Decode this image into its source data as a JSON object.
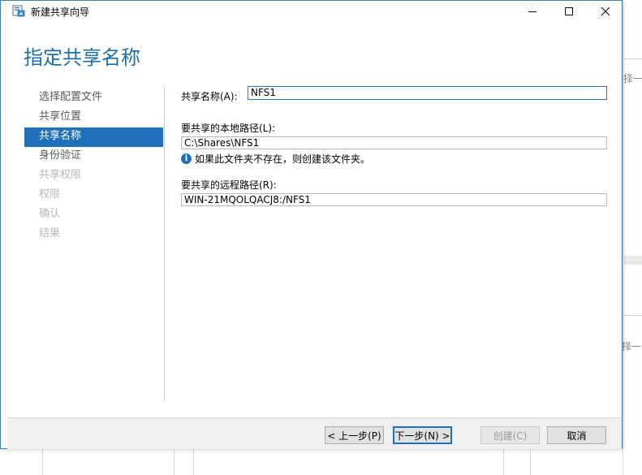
{
  "window": {
    "title": "新建共享向导"
  },
  "page": {
    "heading": "指定共享名称"
  },
  "nav": {
    "items": [
      {
        "label": "选择配置文件",
        "state": "normal"
      },
      {
        "label": "共享位置",
        "state": "normal"
      },
      {
        "label": "共享名称",
        "state": "active"
      },
      {
        "label": "身份验证",
        "state": "normal"
      },
      {
        "label": "共享权限",
        "state": "disabled"
      },
      {
        "label": "权限",
        "state": "disabled"
      },
      {
        "label": "确认",
        "state": "disabled"
      },
      {
        "label": "结果",
        "state": "disabled"
      }
    ]
  },
  "form": {
    "share_name_label": "共享名称(A):",
    "share_name_value": "NFS1",
    "local_path_label": "要共享的本地路径(L):",
    "local_path_value": "C:\\Shares\\NFS1",
    "info_text": "如果此文件夹不存在，则创建该文件夹。",
    "remote_path_label": "要共享的远程路径(R):",
    "remote_path_value": "WIN-21MQOLQACJ8:/NFS1"
  },
  "footer": {
    "prev_label": "< 上一步(P)",
    "next_label": "下一步(N) >",
    "create_label": "创建(C)",
    "cancel_label": "取消"
  },
  "background": {
    "text_top": "择一",
    "text_bottom": "择一个"
  },
  "colors": {
    "accent": "#1f70b8",
    "heading": "#1e6ea7"
  }
}
